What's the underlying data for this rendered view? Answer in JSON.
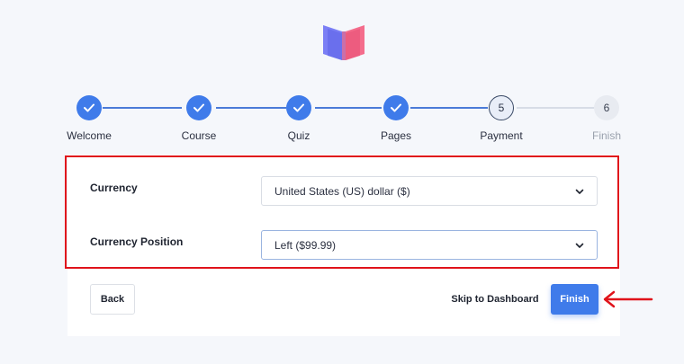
{
  "steps": [
    {
      "label": "Welcome",
      "state": "done",
      "number": ""
    },
    {
      "label": "Course",
      "state": "done",
      "number": ""
    },
    {
      "label": "Quiz",
      "state": "done",
      "number": ""
    },
    {
      "label": "Pages",
      "state": "done",
      "number": ""
    },
    {
      "label": "Payment",
      "state": "current",
      "number": "5"
    },
    {
      "label": "Finish",
      "state": "upcoming",
      "number": "6"
    }
  ],
  "form": {
    "currency": {
      "label": "Currency",
      "value": "United States (US) dollar ($)"
    },
    "currency_position": {
      "label": "Currency Position",
      "value": "Left ($99.99)"
    }
  },
  "footer": {
    "back_label": "Back",
    "skip_label": "Skip to Dashboard",
    "finish_label": "Finish"
  },
  "colors": {
    "accent": "#3f7bea",
    "highlight": "#e0131b",
    "logo_left": "#7b7ff5",
    "logo_right": "#f46d8c"
  }
}
